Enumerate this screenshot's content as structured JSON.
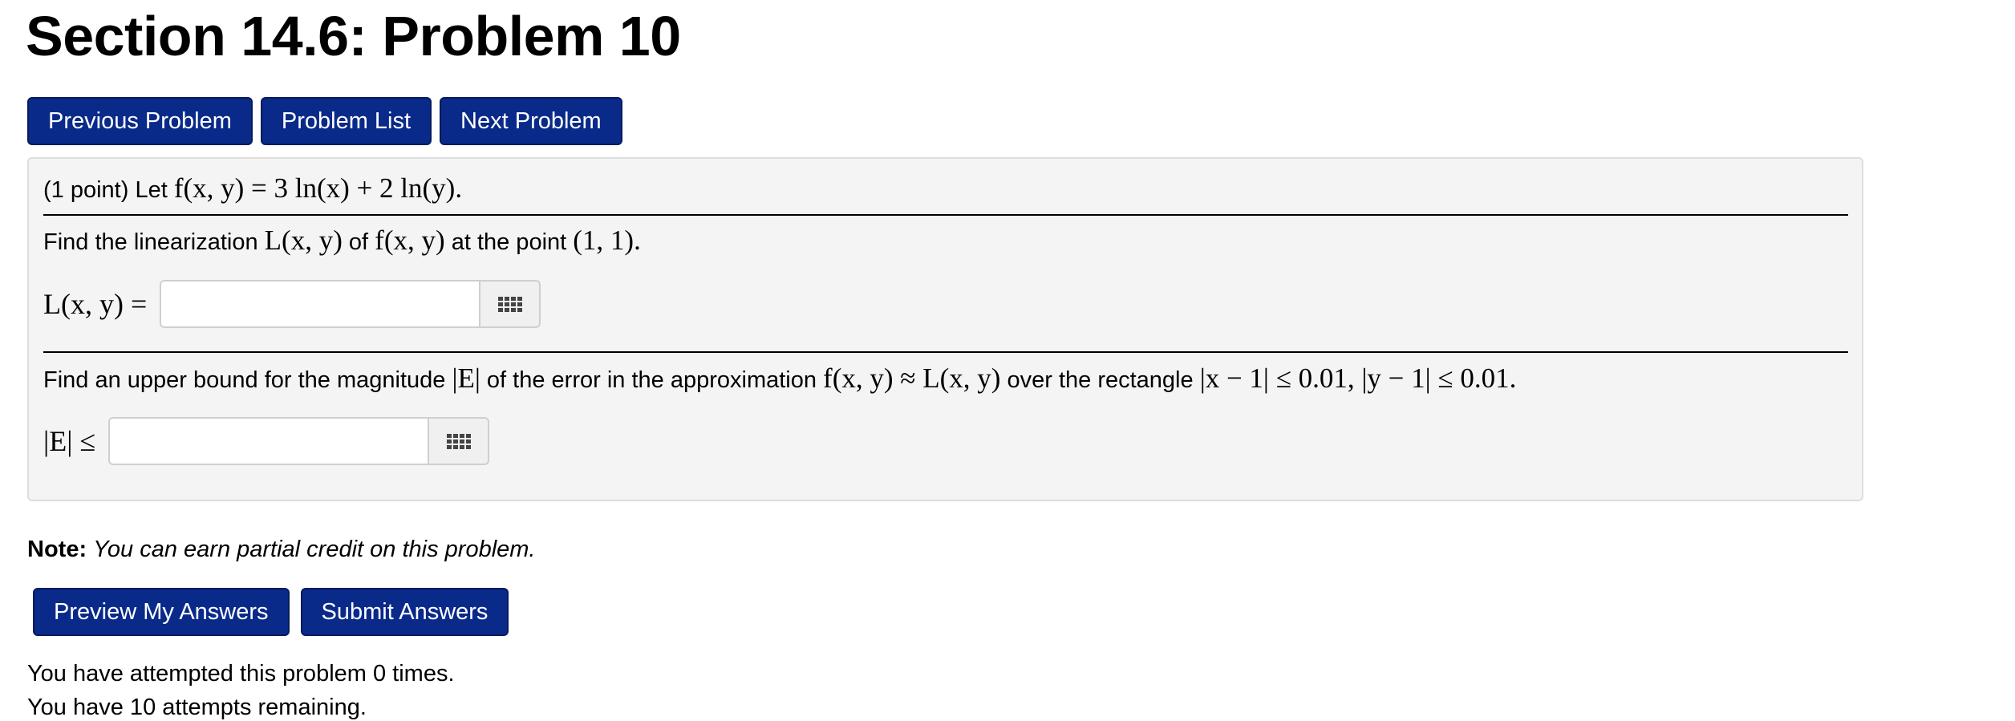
{
  "page": {
    "title": "Section 14.6: Problem 10"
  },
  "nav": {
    "previous_label": "Previous Problem",
    "list_label": "Problem List",
    "next_label": "Next Problem"
  },
  "problem": {
    "intro_prefix": "(1 point) Let ",
    "function_def": "f(x, y) = 3 ln(x) + 2 ln(y).",
    "part1": {
      "prefix": "Find the linearization ",
      "L": "L(x, y)",
      "mid": " of ",
      "f": "f(x, y)",
      "mid2": " at the point ",
      "point": "(1, 1).",
      "answer_label": "L(x, y) =",
      "answer_value": ""
    },
    "part2": {
      "prefix": "Find an upper bound for the magnitude ",
      "E": "|E|",
      "mid": " of the error in the approximation ",
      "approx": "f(x, y) ≈ L(x, y)",
      "mid2": " over the rectangle ",
      "rect": "|x − 1| ≤ 0.01,  |y − 1| ≤ 0.01.",
      "answer_label": "|E| ≤",
      "answer_value": ""
    },
    "equation_editor_icon": "grid-icon"
  },
  "note": {
    "label": "Note:",
    "text": "You can earn partial credit on this problem."
  },
  "actions": {
    "preview_label": "Preview My Answers",
    "submit_label": "Submit Answers"
  },
  "status": {
    "attempts_text": "You have attempted this problem 0 times.",
    "remaining_text": "You have 10 attempts remaining."
  },
  "colors": {
    "button_bg": "#0a2a8a",
    "problem_bg": "#f4f4f4"
  }
}
